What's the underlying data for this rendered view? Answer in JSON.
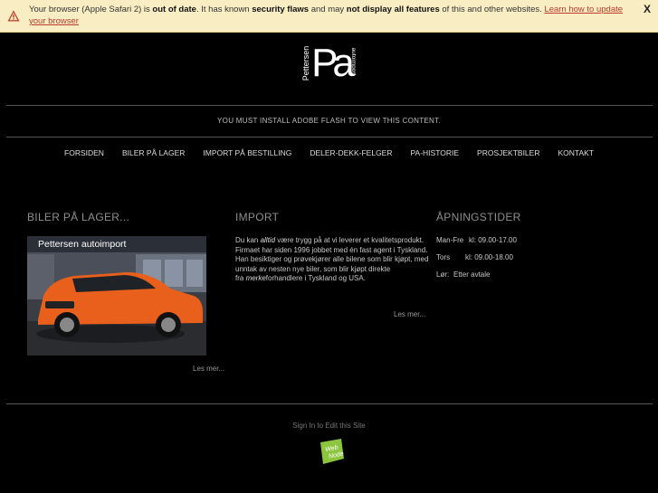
{
  "browser_warning": {
    "part1": "Your browser (Apple Safari 2) is ",
    "bold1": "out of date",
    "part2": ". It has known ",
    "bold2": "security flaws",
    "part3": " and may ",
    "bold3": "not display all features",
    "part4": " of this and other websites. ",
    "link": "Learn how to update your browser",
    "close": "X"
  },
  "logo": {
    "wordmark": "Pettersen",
    "monogram": "Pa",
    "tagline": "autoimport"
  },
  "flash_message": "YOU MUST INSTALL ADOBE FLASH TO VIEW THIS CONTENT.",
  "nav": [
    "FORSIDEN",
    "BILER PÅ LAGER",
    "IMPORT PÅ BESTILLING",
    "DELER-DEKK-FELGER",
    "PA-HISTORIE",
    "PROSJEKTBILER",
    "KONTAKT"
  ],
  "stock": {
    "title": "BILER PÅ LAGER...",
    "image_banner": "Pettersen autoimport",
    "more": "Les mer..."
  },
  "import": {
    "title": "IMPORT",
    "line1a": "Du kan ",
    "line1i": "alltid",
    "line1b": " være trygg på at vi leverer et kvalitetsprodukt.",
    "body": "Firmaet har siden 1996 jobbet med én fast agent i Tyskland. Han besiktiger og prøvekjører alle bilene som blir kjøpt, med unntak av nesten nye biler, som blir kjøpt direkte",
    "line3a": "fra ",
    "line3i": "merke",
    "line3b": "forhandlere i Tyskland og USA.",
    "more": "Les mer..."
  },
  "hours": {
    "title": "ÅPNINGSTIDER",
    "rows": [
      {
        "day": "Man-Fre",
        "time": "kl: 09.00-17.00"
      },
      {
        "day": "Tors",
        "time": "kl: 09.00-18.00"
      },
      {
        "day": "Lør:",
        "time": "Etter avtale"
      }
    ]
  },
  "footer": {
    "signin": "Sign In to Edit this Site",
    "badge_line1": "Web",
    "badge_line2": "Node"
  },
  "colors": {
    "background": "#000000",
    "warning_bg": "#f9eec3",
    "car": "#e8601c",
    "badge": "#8cc63f"
  }
}
